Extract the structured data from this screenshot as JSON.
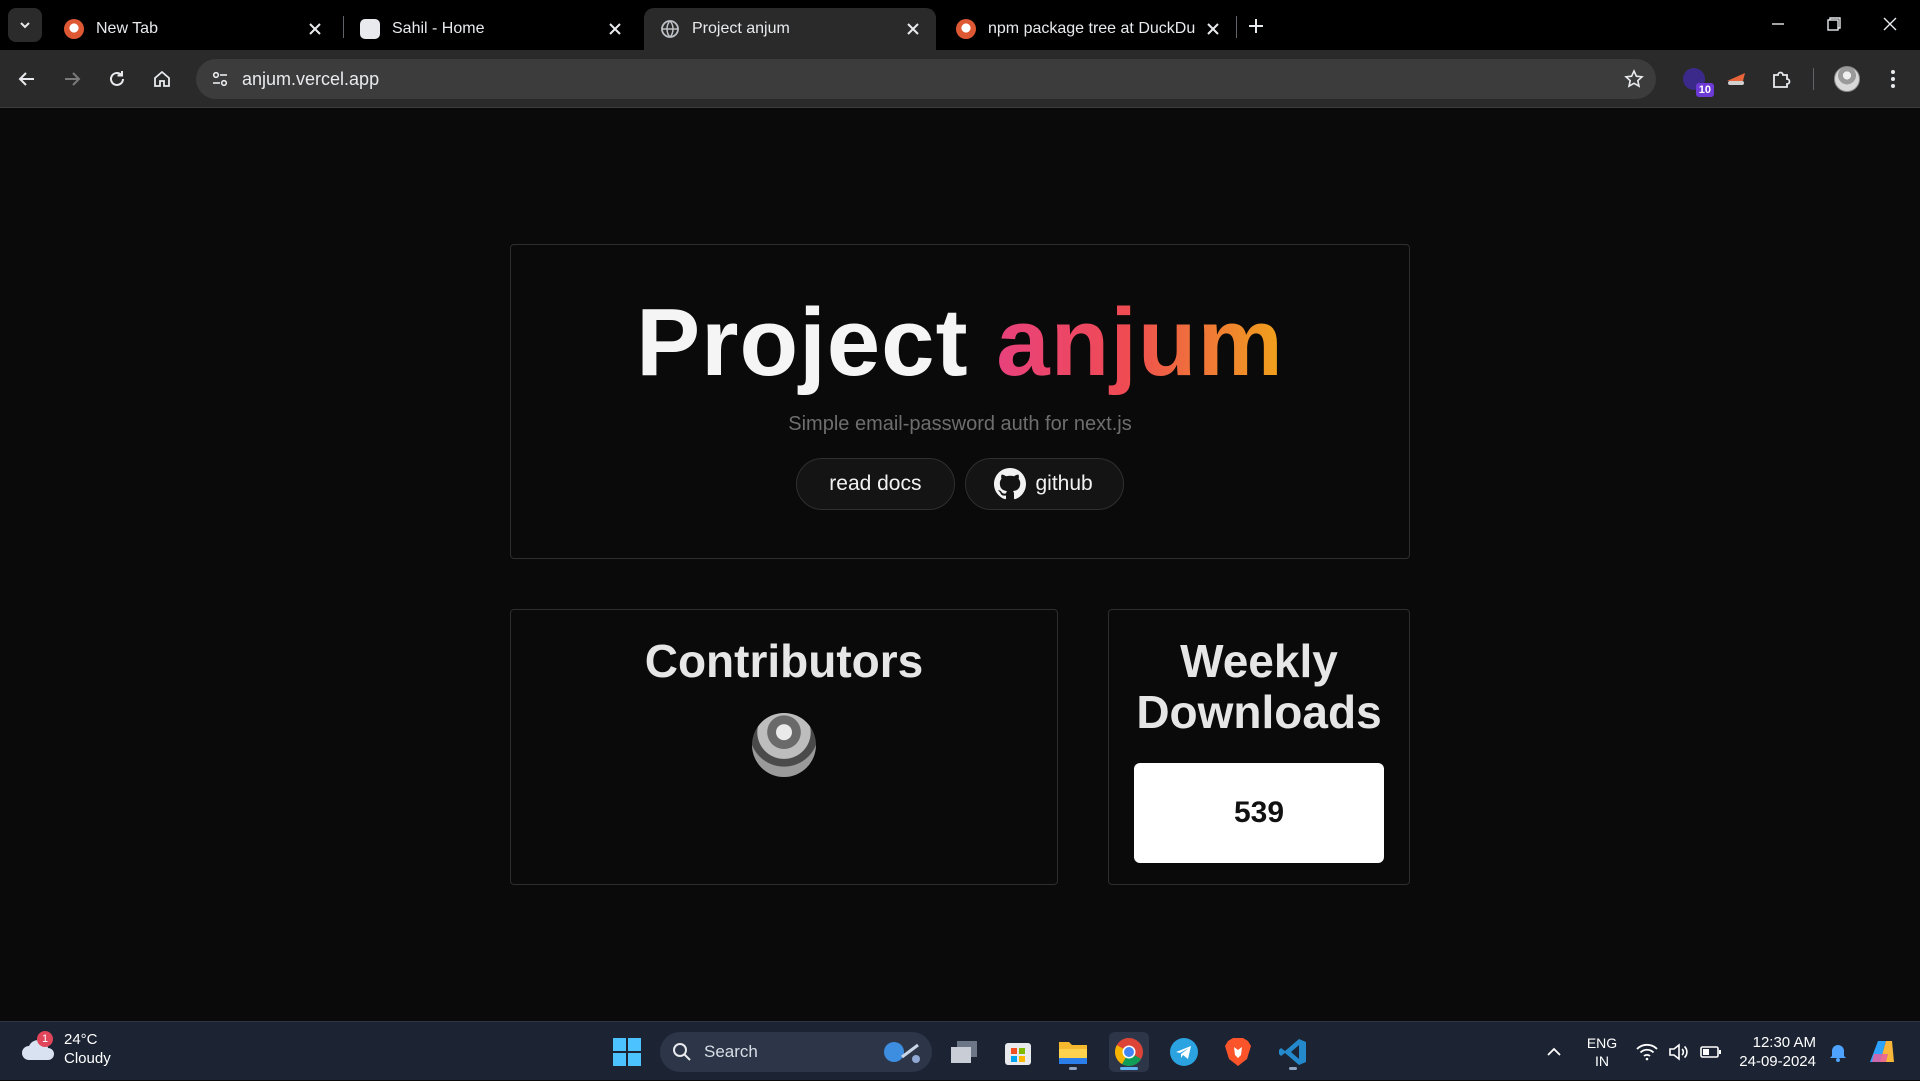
{
  "browser": {
    "tabs": [
      {
        "title": "New Tab",
        "favicon": "duckduckgo-icon",
        "active": false
      },
      {
        "title": "Sahil - Home",
        "favicon": "page-icon",
        "active": false
      },
      {
        "title": "Project anjum",
        "favicon": "globe-icon",
        "active": true
      },
      {
        "title": "npm package tree at DuckDuckGo",
        "favicon": "duckduckgo-icon",
        "active": false
      }
    ],
    "url": "anjum.vercel.app",
    "extension_badge": "10"
  },
  "hero": {
    "title_main": "Project",
    "title_accent": "anjum",
    "subtitle": "Simple email-password auth for next.js",
    "docs_button": "read docs",
    "github_button": "github",
    "accent_gradient": [
      "#e8417d",
      "#ef4b53",
      "#f0a31a"
    ]
  },
  "contributors": {
    "heading": "Contributors"
  },
  "downloads": {
    "heading_line1": "Weekly",
    "heading_line2": "Downloads",
    "count": "539"
  },
  "taskbar": {
    "weather_temp": "24°C",
    "weather_condition": "Cloudy",
    "weather_badge": "1",
    "search_label": "Search",
    "lang_line1": "ENG",
    "lang_line2": "IN",
    "time": "12:30 AM",
    "date": "24-09-2024",
    "pinned": [
      "task-view-icon",
      "microsoft-store-icon",
      "file-explorer-icon",
      "chrome-icon",
      "telegram-icon",
      "brave-icon",
      "vscode-icon"
    ]
  }
}
